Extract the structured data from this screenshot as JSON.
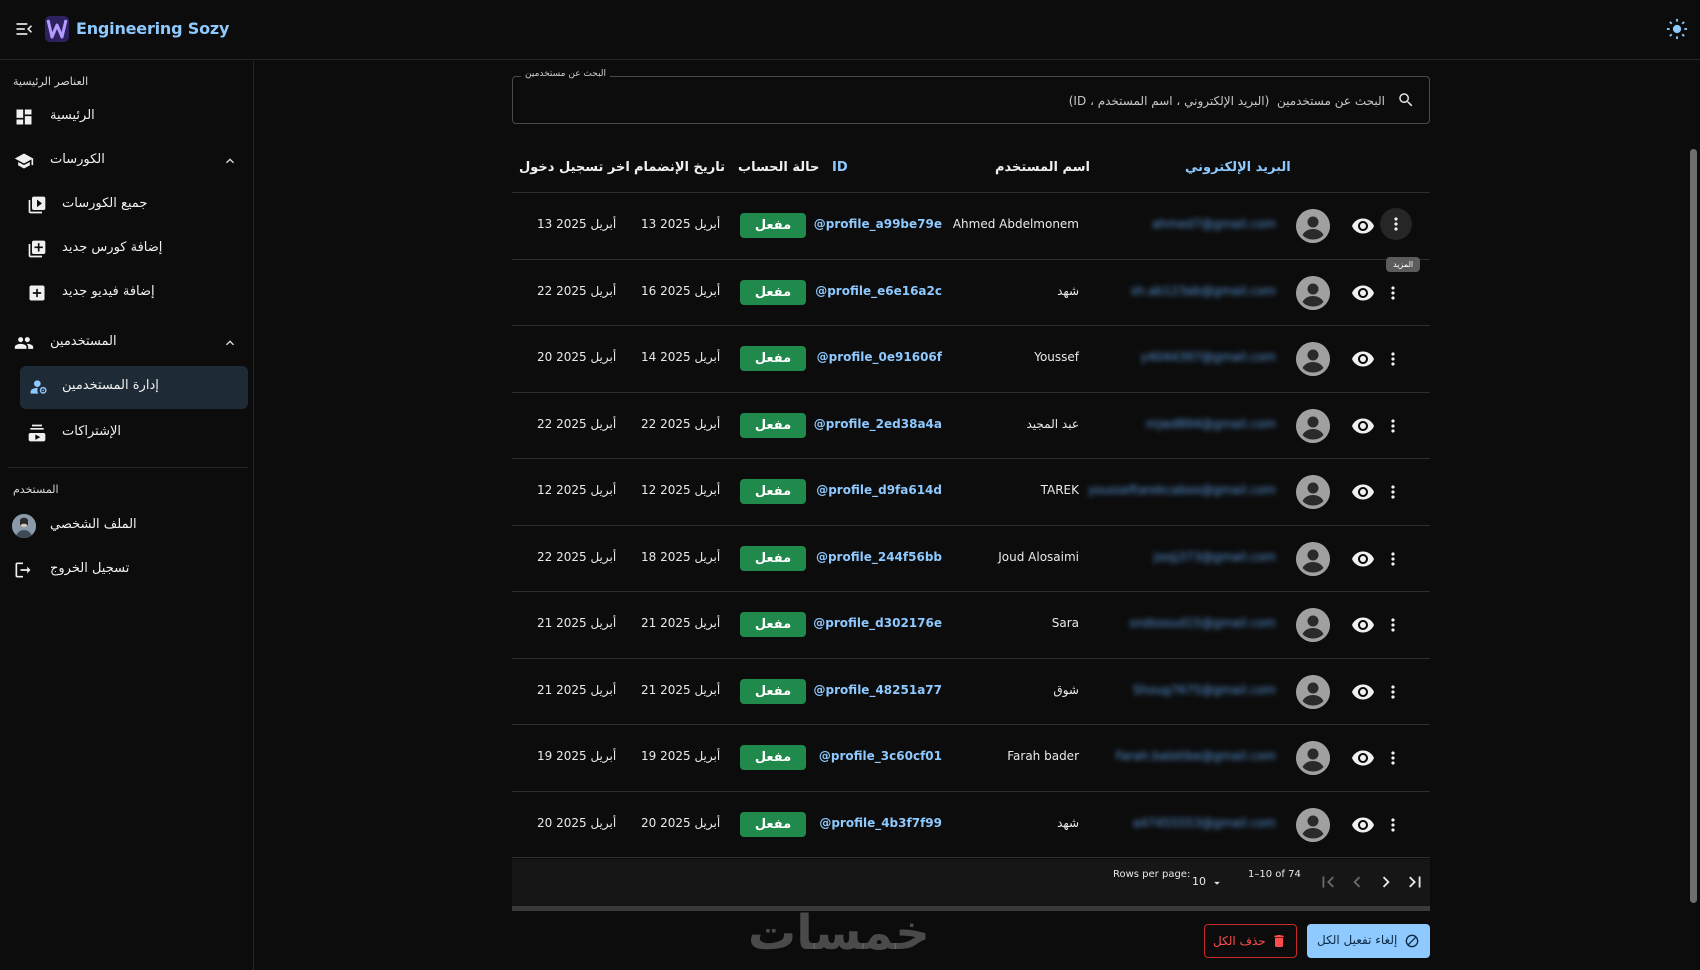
{
  "app": {
    "brand": "Engineering Sozy"
  },
  "sidebar": {
    "main_section": "العناصر الرئيسية",
    "user_section": "المستخدم",
    "items": {
      "home": "الرئيسية",
      "courses": "الكورسات",
      "all_courses": "جميع الكورسات",
      "add_course": "إضافة كورس جديد",
      "add_video": "إضافة فيديو جديد",
      "users": "المستخدمين",
      "manage_users": "إدارة المستخدمين",
      "subscriptions": "الإشتراكات",
      "profile": "الملف الشخصي",
      "logout": "تسجيل الخروج"
    }
  },
  "search": {
    "legend": "البحث عن مستخدمين",
    "placeholder": "البحث عن مستخدمين  (البريد الإلكتروني ، اسم المستخدم ، ID)",
    "value": ""
  },
  "table": {
    "headers": {
      "email": "البريد الإلكتروني",
      "username": "اسم المستخدم",
      "id": "ID",
      "status": "حالة الحساب",
      "joined": "تاريخ الإنضمام",
      "last_login": "اخر تسجيل دخول"
    },
    "rows": [
      {
        "email": "ahmed7@gmail.com",
        "username": "Ahmed Abdelmonem",
        "id": "@profile_a99be79e",
        "status": "مفعل",
        "joined": "13 أبريل 2025",
        "last_login": "13 أبريل 2025"
      },
      {
        "email": "sh.ab123ab@gmail.com",
        "username": "شهد",
        "id": "@profile_e6e16a2c",
        "status": "مفعل",
        "joined": "16 أبريل 2025",
        "last_login": "22 أبريل 2025"
      },
      {
        "email": "y4044397@gmail.com",
        "username": "Youssef",
        "id": "@profile_0e91606f",
        "status": "مفعل",
        "joined": "14 أبريل 2025",
        "last_login": "20 أبريل 2025"
      },
      {
        "email": "mjwd894@gmail.com",
        "username": "عبد المجيد",
        "id": "@profile_2ed38a4a",
        "status": "مفعل",
        "joined": "22 أبريل 2025",
        "last_login": "22 أبريل 2025"
      },
      {
        "email": "yousseftarekcaboo@gmail.com",
        "username": "TAREK",
        "id": "@profile_d9fa614d",
        "status": "مفعل",
        "joined": "12 أبريل 2025",
        "last_login": "12 أبريل 2025"
      },
      {
        "email": "joojj373@gmail.com",
        "username": "Joud Alosaimi",
        "id": "@profile_244f56bb",
        "status": "مفعل",
        "joined": "18 أبريل 2025",
        "last_login": "22 أبريل 2025"
      },
      {
        "email": "sndssoud15@gmail.com",
        "username": "Sara",
        "id": "@profile_d302176e",
        "status": "مفعل",
        "joined": "21 أبريل 2025",
        "last_login": "21 أبريل 2025"
      },
      {
        "email": "Shoug7675@gmail.com",
        "username": "شوق",
        "id": "@profile_48251a77",
        "status": "مفعل",
        "joined": "21 أبريل 2025",
        "last_login": "21 أبريل 2025"
      },
      {
        "email": "Farah.balotibe@gmail.com",
        "username": "Farah bader",
        "id": "@profile_3c60cf01",
        "status": "مفعل",
        "joined": "19 أبريل 2025",
        "last_login": "19 أبريل 2025"
      },
      {
        "email": "a47455553@gmail.com",
        "username": "شهد",
        "id": "@profile_4b3f7f99",
        "status": "مفعل",
        "joined": "20 أبريل 2025",
        "last_login": "20 أبريل 2025"
      }
    ],
    "tooltip": "المزيد"
  },
  "pagination": {
    "rows_per_page_label": "Rows per page:",
    "rows_per_page": "10",
    "range": "1–10 of 74"
  },
  "actions": {
    "delete_all": "حذف الكل",
    "deactivate_all": "إلغاء تفعيل الكل"
  },
  "watermark": "خمسات",
  "colors": {
    "accent": "#8ec9ff",
    "active_badge": "#1f8a4c",
    "danger": "#c62828",
    "background": "#0c0c0c"
  }
}
